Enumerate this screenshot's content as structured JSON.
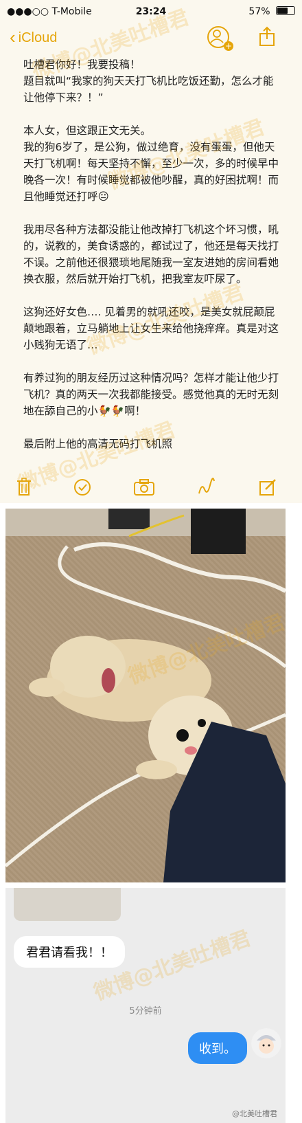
{
  "statusbar": {
    "carrier": "●●●○○ T-Mobile",
    "time": "23:24",
    "battery": "57%"
  },
  "navbar": {
    "back_label": "iCloud",
    "icons": [
      "back-chevron-icon",
      "add-person-icon",
      "share-icon"
    ]
  },
  "note": {
    "text": "吐槽君你好！我要投稿！\n题目就叫“我家的狗天天打飞机比吃饭还勤，怎么才能让他停下来？！”\n\n本人女，但这跟正文无关。\n我的狗6岁了，是公狗，做过绝育，没有蛋蛋，但他天天打飞机啊！每天坚持不懈，至少一次，多的时候早中晚各一次！有时候睡觉都被他吵醒，真的好困扰啊！而且他睡觉还打呼😐\n\n我用尽各种方法都没能让他改掉打飞机这个坏习惯，吼的，说教的，美食诱惑的，都试过了，他还是每天找打不误。之前他还很猥琐地尾随我一室友进她的房间看她换衣服，然后就开始打飞机，把我室友吓尿了。\n\n这狗还好女色…. 见着男的就吼还咬，是美女就屁颠屁颠地跟着，立马躺地上让女生来给他挠痒痒。真是对这小贱狗无语了…\n\n有养过狗的朋友经历过这种情况吗？怎样才能让他少打飞机？真的两天一次我都能接受。感觉他真的无时无刻地在舔自己的小🐓🐓啊！\n\n最后附上他的高清无码打飞机照"
  },
  "toolbar": {
    "icons": [
      "trash-icon",
      "checklist-icon",
      "camera-icon",
      "sketch-icon",
      "compose-icon"
    ]
  },
  "chat": {
    "incoming": "君君请看我！！",
    "timestamp": "5分钟前",
    "outgoing": "收到。",
    "credit": "@北美吐槽君"
  },
  "watermark": "微博@北美吐槽君",
  "colors": {
    "accent": "#e5a50a",
    "note_bg": "#fbf8ee",
    "bubble_blue": "#2e8ef3"
  }
}
